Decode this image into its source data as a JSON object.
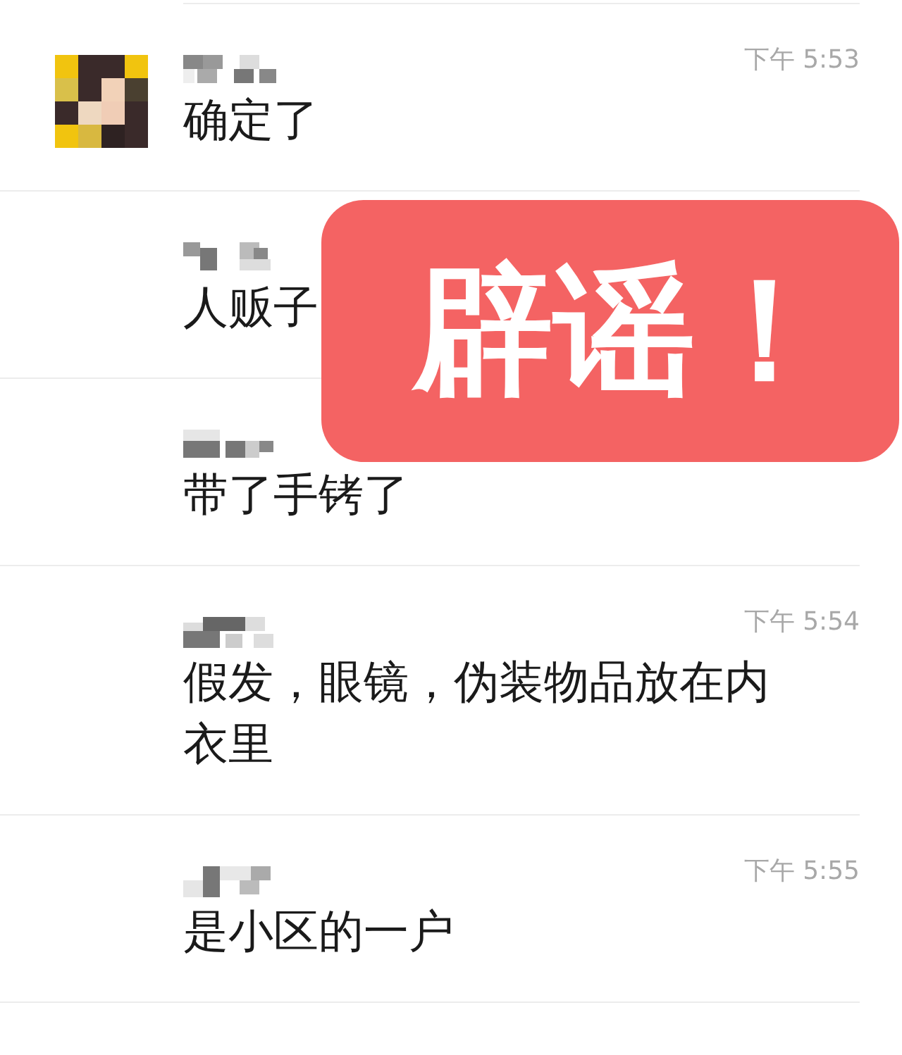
{
  "messages": [
    {
      "avatar": true,
      "time": "下午 5:53",
      "text": "确定了"
    },
    {
      "avatar": false,
      "text": "人贩子"
    },
    {
      "avatar": false,
      "text": "带了手铐了"
    },
    {
      "avatar": false,
      "time": "下午 5:54",
      "text": "假发，眼镜，伪装物品放在内衣里"
    },
    {
      "avatar": false,
      "time": "下午 5:55",
      "text": "是小区的一户"
    }
  ],
  "stamp": {
    "text": "辟谣！"
  }
}
